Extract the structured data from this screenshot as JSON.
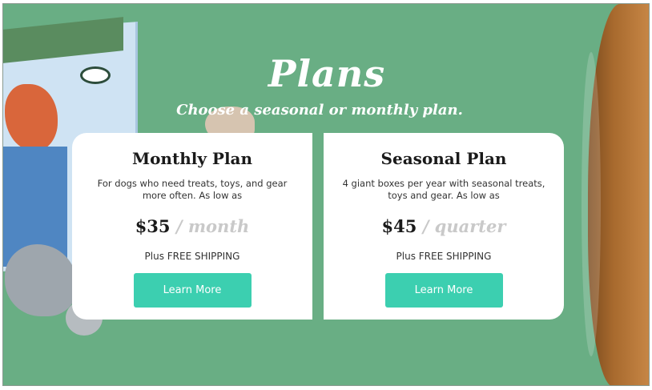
{
  "hero": {
    "title": "Plans",
    "subtitle": "Choose a seasonal or monthly plan."
  },
  "plans": [
    {
      "title": "Monthly Plan",
      "description": "For dogs who need treats, toys, and gear more often. As low as",
      "price": "$35",
      "period": "/ month",
      "shipping": "Plus FREE SHIPPING",
      "button_label": "Learn More"
    },
    {
      "title": "Seasonal Plan",
      "description": "4 giant boxes per year with seasonal treats, toys and gear. As low as",
      "price": "$45",
      "period": "/ quarter",
      "shipping": "Plus FREE SHIPPING",
      "button_label": "Learn More"
    }
  ],
  "colors": {
    "background": "#69ae84",
    "button": "#3ccfb0",
    "card": "#ffffff"
  }
}
